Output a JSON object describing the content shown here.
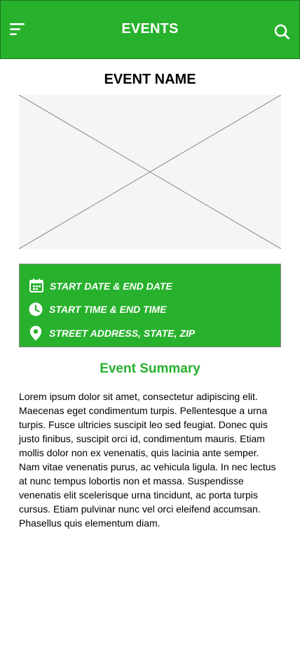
{
  "header": {
    "title": "EVENTS",
    "menu_icon": "hamburger-menu-icon",
    "search_icon": "search-icon"
  },
  "event": {
    "name": "EVENT NAME",
    "image_placeholder": "image-placeholder-icon"
  },
  "details": {
    "date": {
      "icon": "calendar-icon",
      "label": "START DATE & END DATE"
    },
    "time": {
      "icon": "clock-icon",
      "label": "START TIME & END TIME"
    },
    "location": {
      "icon": "location-pin-icon",
      "label": "STREET ADDRESS, STATE, ZIP"
    }
  },
  "summary": {
    "heading": "Event Summary",
    "body": "Lorem ipsum dolor sit amet, consectetur adipiscing elit. Maecenas eget condimentum turpis. Pellentesque a urna turpis. Fusce ultricies suscipit leo sed feugiat. Donec quis justo finibus, suscipit orci id, condimentum mauris. Etiam mollis dolor non ex venenatis, quis lacinia ante semper. Nam vitae venenatis purus, ac vehicula ligula. In nec lectus at nunc tempus lobortis non et massa. Suspendisse venenatis elit scelerisque urna tincidunt, ac porta turpis cursus. Etiam pulvinar nunc vel orci eleifend accumsan. Phasellus quis elementum diam."
  },
  "colors": {
    "brand_green": "#28b12d",
    "white": "#ffffff",
    "placeholder_gray": "#f5f5f5",
    "line_gray": "#8a8a8a"
  }
}
